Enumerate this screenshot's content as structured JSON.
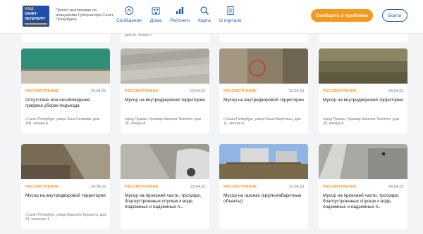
{
  "header": {
    "logo": {
      "line1": "НАШ",
      "line2": "САНКТ-",
      "line3": "ПЕТЕРБУРГ"
    },
    "tagline": "Проект реализован по инициативе Губернатора Санкт-Петербурга",
    "nav": [
      {
        "label": "Сообщения",
        "icon": "messages-icon"
      },
      {
        "label": "Дома",
        "icon": "buildings-icon"
      },
      {
        "label": "Рейтинги",
        "icon": "ratings-icon"
      },
      {
        "label": "Карта",
        "icon": "map-search-icon"
      },
      {
        "label": "О портале",
        "icon": "document-icon"
      }
    ],
    "report_button": "Сообщить о проблеме",
    "login_button": "Войти"
  },
  "top_row": [
    {
      "address": ""
    },
    {
      "address": "дом 28, литера А"
    },
    {
      "address": ""
    },
    {
      "address": ""
    }
  ],
  "cards": [
    {
      "status": "РАССМОТРЕНИЕ",
      "date": "23.04.23",
      "title": "Отсутствие или несоблюдение графика уборки подъезда",
      "address": "г.Санкт-Петербург, улица Лёни Голикова, дом 108, литера А"
    },
    {
      "status": "РАССМОТРЕНИЕ",
      "date": "23.04.23",
      "title": "Мусор на внутридворовой территории",
      "address": "город Пушкин, бульвар Алексея Толстого, дом 28, литера А"
    },
    {
      "status": "РАССМОТРЕНИЕ",
      "date": "23.04.23",
      "title": "Мусор на внутридворовой территории",
      "address": "г.Санкт-Петербург, улица Ольги Берггольц, дом 11, литера А"
    },
    {
      "status": "РАССМОТРЕНИЕ",
      "date": "24.04.23",
      "title": "Мусор на внутридворовой территории",
      "address": "город Пушкин, бульвар Алексея Толстого, дом 28, литера А"
    },
    {
      "status": "РАССМОТРЕНИЕ",
      "date": "24.04.23",
      "title": "Мусор на внутридворовой территории",
      "address": "г.Санкт-Петербург, улица Красного Курсанта, дом 31, строение 1"
    },
    {
      "status": "РАССМОТРЕНИЕ",
      "date": "23.04.23",
      "title": "Мусор на проезжей части, тротуаре, благоустроенных спусках к воде, подземных и надземных п...",
      "address": ""
    },
    {
      "status": "РАССМОТРЕНИЕ",
      "date": "23.04.23",
      "title": "Мусор на газонах (крупногабаритные объекты)",
      "address": ""
    },
    {
      "status": "РАССМОТРЕНИЕ",
      "date": "24.04.23",
      "title": "Мусор на проезжей части, тротуаре, благоустроенных спусках к воде, подземных и надземных п...",
      "address": ""
    }
  ],
  "colors": {
    "accent": "#f39a1e",
    "brand": "#1f5fbf",
    "logo_bg": "#1f4fa6"
  }
}
